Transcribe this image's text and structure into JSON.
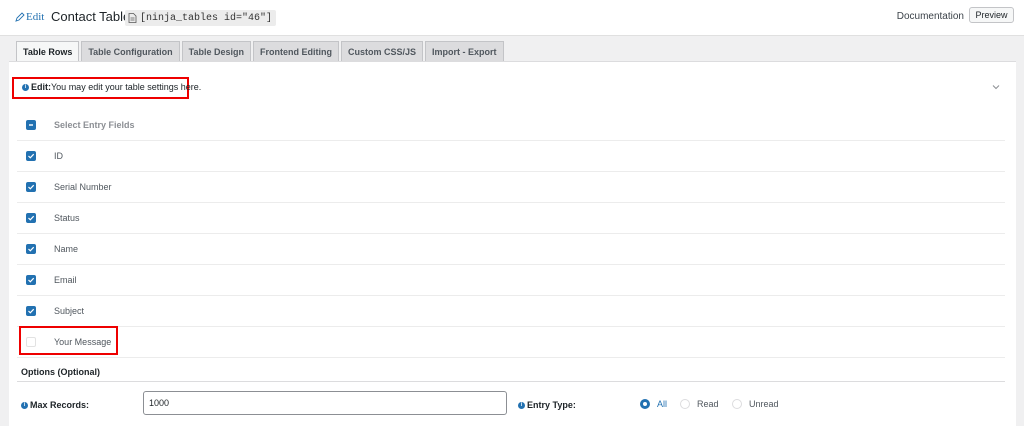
{
  "header": {
    "edit_label": "Edit",
    "title": "Contact Table",
    "shortcode": "[ninja_tables id=\"46\"]",
    "documentation": "Documentation",
    "preview": "Preview"
  },
  "tabs": [
    {
      "label": "Table Rows",
      "active": true
    },
    {
      "label": "Table Configuration"
    },
    {
      "label": "Table Design"
    },
    {
      "label": "Frontend Editing"
    },
    {
      "label": "Custom CSS/JS"
    },
    {
      "label": "Import - Export"
    }
  ],
  "notice": {
    "bold": "Edit:",
    "text": "You may edit your table settings here."
  },
  "fields": {
    "select_all": {
      "label": "Select Entry Fields",
      "checked": true
    },
    "items": [
      {
        "label": "ID",
        "checked": true
      },
      {
        "label": "Serial Number",
        "checked": true
      },
      {
        "label": "Status",
        "checked": true
      },
      {
        "label": "Name",
        "checked": true
      },
      {
        "label": "Email",
        "checked": true
      },
      {
        "label": "Subject",
        "checked": true
      },
      {
        "label": "Your Message",
        "checked": false
      }
    ]
  },
  "options": {
    "title": "Options (Optional)",
    "max_records_label": "Max Records:",
    "max_records_value": "1000",
    "entry_type_label": "Entry Type:",
    "entry_types": [
      {
        "label": "All",
        "selected": true
      },
      {
        "label": "Read",
        "selected": false
      },
      {
        "label": "Unread",
        "selected": false
      }
    ]
  },
  "colors": {
    "accent": "#2271b1",
    "highlight": "#e00000"
  },
  "icons": [
    "pencil-icon",
    "file-icon",
    "info-icon",
    "chevron-down-icon",
    "checkmark-icon"
  ]
}
